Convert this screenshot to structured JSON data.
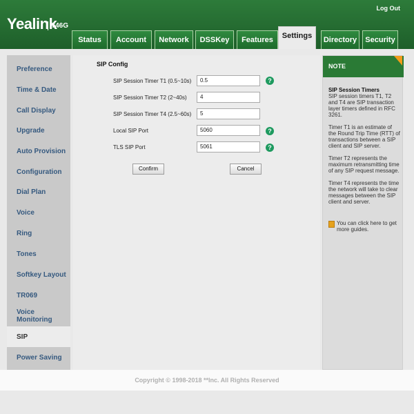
{
  "header": {
    "logo": "Yealink",
    "model": "T46G",
    "logout": "Log Out",
    "tabs": [
      "Status",
      "Account",
      "Network",
      "DSSKey",
      "Features",
      "Settings",
      "Directory",
      "Security"
    ],
    "active_tab": "Settings"
  },
  "sidebar": {
    "items": [
      "Preference",
      "Time & Date",
      "Call Display",
      "Upgrade",
      "Auto Provision",
      "Configuration",
      "Dial Plan",
      "Voice",
      "Ring",
      "Tones",
      "Softkey Layout",
      "TR069",
      "Voice Monitoring",
      "SIP",
      "Power Saving"
    ],
    "active": "SIP"
  },
  "main": {
    "section_title": "SIP Config",
    "fields": [
      {
        "label": "SIP Session Timer T1 (0.5~10s)",
        "value": "0.5",
        "help": true
      },
      {
        "label": "SIP Session Timer T2 (2~40s)",
        "value": "4",
        "help": false
      },
      {
        "label": "SIP Session Timer T4 (2.5~60s)",
        "value": "5",
        "help": false
      },
      {
        "label": "Local SIP Port",
        "value": "5060",
        "help": true
      },
      {
        "label": "TLS SIP Port",
        "value": "5061",
        "help": true
      }
    ],
    "help_glyph": "?",
    "confirm_label": "Confirm",
    "cancel_label": "Cancel"
  },
  "note": {
    "title": "NOTE",
    "heading": "SIP Session Timers",
    "paragraphs": [
      "SIP session timers T1, T2 and T4 are SIP transaction layer timers defined in RFC 3261.",
      "Timer T1 is an estimate of the Round Trip Time (RTT) of transactions between a SIP client and SIP server.",
      "Timer T2 represents the maximum retransmitting time of any SIP request message.",
      "Timer T4 represents the time the network will take to clear messages between the SIP client and server."
    ],
    "guide": "You can click here to get more guides."
  },
  "footer": {
    "copyright": "Copyright © 1998-2018 **Inc. All Rights Reserved"
  },
  "colors": {
    "header_green": "#2d7b3a",
    "sidebar_link": "#35597f",
    "help_icon": "#1e9a5f",
    "note_corner": "#f29b1a"
  }
}
